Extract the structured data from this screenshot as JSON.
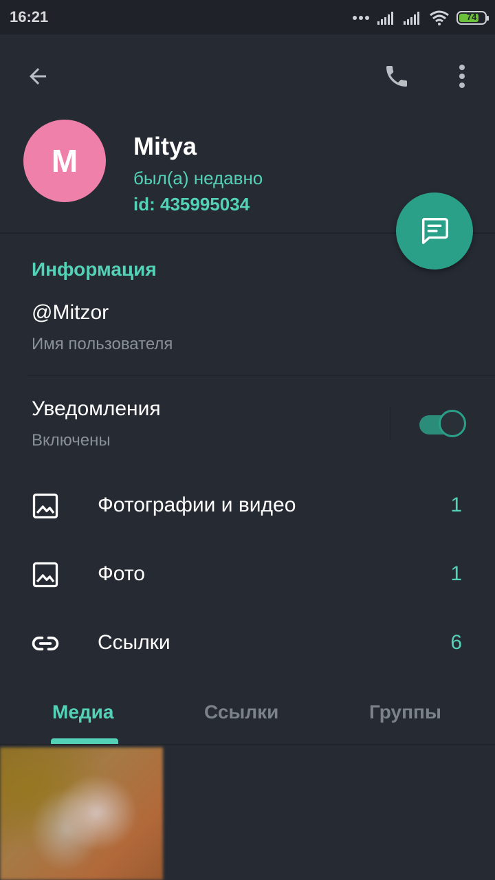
{
  "status_bar": {
    "time": "16:21",
    "battery_level": "74"
  },
  "header": {
    "back_icon": "arrow-left-icon",
    "call_icon": "phone-icon",
    "more_icon": "dots-vertical-icon"
  },
  "profile": {
    "avatar_letter": "M",
    "avatar_color": "#ee80aa",
    "name": "Mitya",
    "status": "был(а) недавно",
    "id": "id: 435995034"
  },
  "fab": {
    "icon": "message-icon"
  },
  "info": {
    "title": "Информация",
    "username": "@Mitzor",
    "username_label": "Имя пользователя",
    "notifications_title": "Уведомления",
    "notifications_status": "Включены",
    "notifications_enabled": true
  },
  "shared": [
    {
      "icon": "image-icon",
      "label": "Фотографии и видео",
      "count": "1"
    },
    {
      "icon": "image-icon",
      "label": "Фото",
      "count": "1"
    },
    {
      "icon": "link-icon",
      "label": "Ссылки",
      "count": "6"
    }
  ],
  "tabs": [
    {
      "label": "Медиа",
      "active": true
    },
    {
      "label": "Ссылки",
      "active": false
    },
    {
      "label": "Группы",
      "active": false
    }
  ],
  "colors": {
    "accent": "#54d2b7",
    "background": "#262b33",
    "fab": "#2aa089"
  }
}
